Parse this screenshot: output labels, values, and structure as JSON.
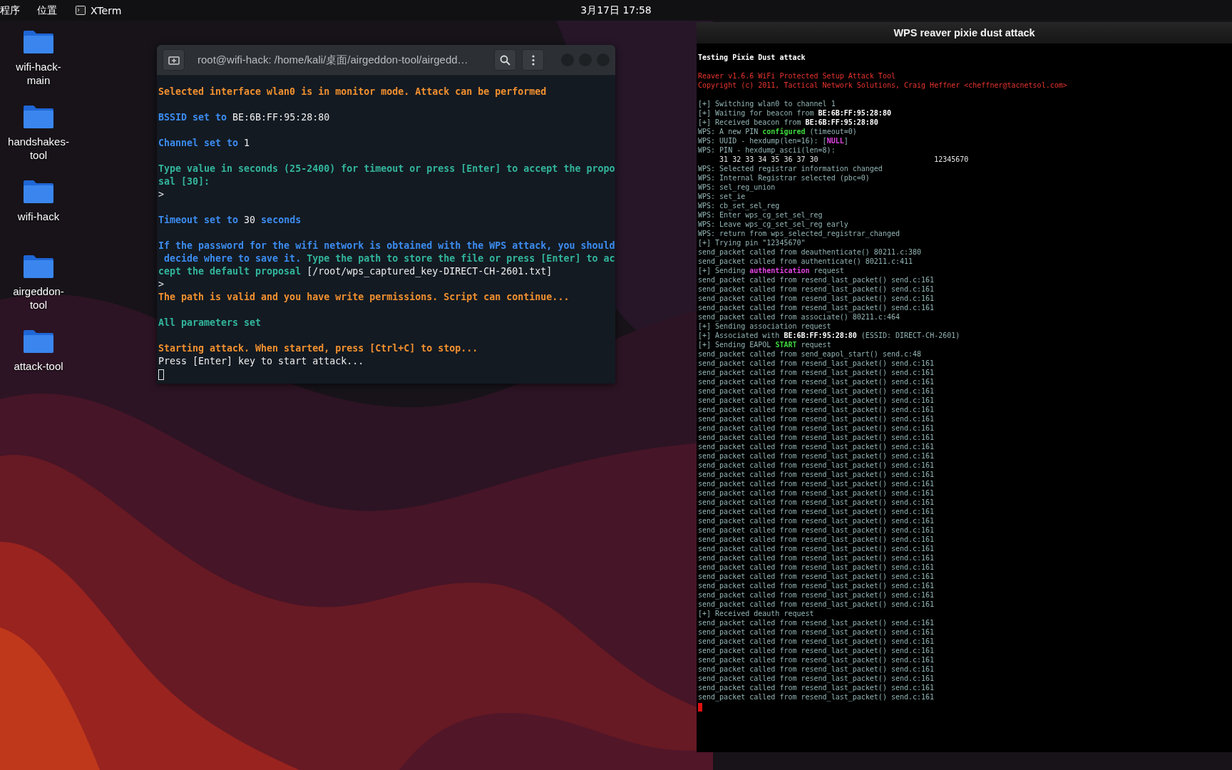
{
  "top_bar": {
    "apps_menu": "程序",
    "places_menu": "位置",
    "taskbar_app": "XTerm",
    "clock": "3月17日  17:58"
  },
  "desktop_icons": [
    {
      "label": "wifi-hack-main"
    },
    {
      "label": "handshakes-tool"
    },
    {
      "label": "wifi-hack"
    },
    {
      "label": "airgeddon-tool"
    },
    {
      "label": "attack-tool"
    }
  ],
  "terminal_window": {
    "title": "root@wifi-hack: /home/kali/桌面/airgeddon-tool/airgedd…",
    "lines": [
      {
        "kind": "blank"
      },
      {
        "kind": "text",
        "segments": [
          {
            "kind": "warning",
            "text": "Selected interface wlan0 is in monitor mode. Attack can be performed"
          }
        ]
      },
      {
        "kind": "blank"
      },
      {
        "kind": "text",
        "segments": [
          {
            "kind": "info",
            "text": "BSSID set to "
          },
          {
            "kind": "plain",
            "text": "BE:6B:FF:95:28:80"
          }
        ]
      },
      {
        "kind": "blank"
      },
      {
        "kind": "text",
        "segments": [
          {
            "kind": "info",
            "text": "Channel set to "
          },
          {
            "kind": "plain",
            "text": "1"
          }
        ]
      },
      {
        "kind": "blank"
      },
      {
        "kind": "text",
        "segments": [
          {
            "kind": "prompt",
            "text": "Type value in seconds (25-2400) for timeout or press [Enter] to accept the propo"
          }
        ]
      },
      {
        "kind": "text",
        "segments": [
          {
            "kind": "prompt",
            "text": "sal [30]:"
          }
        ]
      },
      {
        "kind": "text",
        "segments": [
          {
            "kind": "plain",
            "text": ">"
          }
        ]
      },
      {
        "kind": "blank"
      },
      {
        "kind": "text",
        "segments": [
          {
            "kind": "info",
            "text": "Timeout set to "
          },
          {
            "kind": "plain",
            "text": "30"
          },
          {
            "kind": "info",
            "text": " seconds"
          }
        ]
      },
      {
        "kind": "blank"
      },
      {
        "kind": "text",
        "segments": [
          {
            "kind": "info",
            "text": "If the password for the wifi network is obtained with the WPS attack, you should"
          }
        ]
      },
      {
        "kind": "text",
        "segments": [
          {
            "kind": "info",
            "text": " decide where to save it."
          },
          {
            "kind": "prompt",
            "text": " Type the path to store the file or press [Enter] to ac"
          }
        ]
      },
      {
        "kind": "text",
        "segments": [
          {
            "kind": "prompt",
            "text": "cept the default proposal"
          },
          {
            "kind": "plain",
            "text": " [/root/wps_captured_key-DIRECT-CH-2601.txt]"
          }
        ]
      },
      {
        "kind": "text",
        "segments": [
          {
            "kind": "plain",
            "text": ">"
          }
        ]
      },
      {
        "kind": "text",
        "segments": [
          {
            "kind": "warning",
            "text": "The path is valid and you have write permissions. Script can continue..."
          }
        ]
      },
      {
        "kind": "blank"
      },
      {
        "kind": "text",
        "segments": [
          {
            "kind": "prompt",
            "text": "All parameters set"
          }
        ]
      },
      {
        "kind": "blank"
      },
      {
        "kind": "text",
        "segments": [
          {
            "kind": "warning",
            "text": "Starting attack. When started, press [Ctrl+C] to stop..."
          }
        ]
      },
      {
        "kind": "text",
        "segments": [
          {
            "kind": "plain",
            "text": "Press [Enter] key to start attack..."
          }
        ]
      }
    ]
  },
  "xterm_window": {
    "title": "WPS reaver pixie dust attack",
    "lines": [
      {
        "kind": "blank"
      },
      {
        "kind": "text",
        "segments": [
          {
            "kind": "header",
            "text": "Testing Pixie Dust attack"
          }
        ]
      },
      {
        "kind": "blank"
      },
      {
        "kind": "text",
        "segments": [
          {
            "kind": "error",
            "text": "Reaver v1.6.6 WiFi Protected Setup Attack Tool"
          }
        ]
      },
      {
        "kind": "text",
        "segments": [
          {
            "kind": "error",
            "text": "Copyright (c) 2011, Tactical Network Solutions, Craig Heffner <cheffner@tacnetsol.com>"
          }
        ]
      },
      {
        "kind": "blank"
      },
      {
        "kind": "text",
        "segments": [
          {
            "kind": "log",
            "text": "[+] Switching wlan0 to channel 1"
          }
        ]
      },
      {
        "kind": "text",
        "segments": [
          {
            "kind": "log",
            "text": "[+] Waiting for beacon from "
          },
          {
            "kind": "highlight",
            "text": "BE:6B:FF:95:28:80"
          }
        ]
      },
      {
        "kind": "text",
        "segments": [
          {
            "kind": "log",
            "text": "[+] Received beacon from "
          },
          {
            "kind": "highlight",
            "text": "BE:6B:FF:95:28:80"
          }
        ]
      },
      {
        "kind": "text",
        "segments": [
          {
            "kind": "log",
            "text": "WPS: A new PIN "
          },
          {
            "kind": "success",
            "text": "configured"
          },
          {
            "kind": "log",
            "text": " (timeout=0)"
          }
        ]
      },
      {
        "kind": "text",
        "segments": [
          {
            "kind": "log",
            "text": "WPS: UUID - hexdump(len=16): ["
          },
          {
            "kind": "accent",
            "text": "NULL"
          },
          {
            "kind": "log",
            "text": "]"
          }
        ]
      },
      {
        "kind": "text",
        "segments": [
          {
            "kind": "log",
            "text": "WPS: PIN - hexdump_ascii(len=8):"
          }
        ]
      },
      {
        "kind": "text",
        "segments": [
          {
            "kind": "value",
            "text": "     31 32 33 34 35 36 37 30                           12345670"
          }
        ]
      },
      {
        "kind": "text",
        "segments": [
          {
            "kind": "log",
            "text": "WPS: Selected registrar information changed"
          }
        ]
      },
      {
        "kind": "text",
        "segments": [
          {
            "kind": "log",
            "text": "WPS: Internal Registrar selected (pbc=0)"
          }
        ]
      },
      {
        "kind": "text",
        "segments": [
          {
            "kind": "log",
            "text": "WPS: sel_reg_union"
          }
        ]
      },
      {
        "kind": "text",
        "segments": [
          {
            "kind": "log",
            "text": "WPS: set_ie"
          }
        ]
      },
      {
        "kind": "text",
        "segments": [
          {
            "kind": "log",
            "text": "WPS: cb_set_sel_reg"
          }
        ]
      },
      {
        "kind": "text",
        "segments": [
          {
            "kind": "log",
            "text": "WPS: Enter wps_cg_set_sel_reg"
          }
        ]
      },
      {
        "kind": "text",
        "segments": [
          {
            "kind": "log",
            "text": "WPS: Leave wps_cg_set_sel_reg early"
          }
        ]
      },
      {
        "kind": "text",
        "segments": [
          {
            "kind": "log",
            "text": "WPS: return from wps_selected_registrar_changed"
          }
        ]
      },
      {
        "kind": "text",
        "segments": [
          {
            "kind": "log",
            "text": "[+] Trying pin \"12345670\""
          }
        ]
      },
      {
        "kind": "text",
        "segments": [
          {
            "kind": "log",
            "text": "send_packet called from deauthenticate() 80211.c:380"
          }
        ]
      },
      {
        "kind": "text",
        "segments": [
          {
            "kind": "log",
            "text": "send_packet called from authenticate() 80211.c:411"
          }
        ]
      },
      {
        "kind": "text",
        "segments": [
          {
            "kind": "log",
            "text": "[+] Sending "
          },
          {
            "kind": "accent",
            "text": "authentication"
          },
          {
            "kind": "log",
            "text": " request"
          }
        ]
      },
      {
        "kind": "text",
        "segments": [
          {
            "kind": "log",
            "text": "send_packet called from resend_last_packet() send.c:161"
          }
        ]
      },
      {
        "kind": "text",
        "segments": [
          {
            "kind": "log",
            "text": "send_packet called from resend_last_packet() send.c:161"
          }
        ]
      },
      {
        "kind": "text",
        "segments": [
          {
            "kind": "log",
            "text": "send_packet called from resend_last_packet() send.c:161"
          }
        ]
      },
      {
        "kind": "text",
        "segments": [
          {
            "kind": "log",
            "text": "send_packet called from resend_last_packet() send.c:161"
          }
        ]
      },
      {
        "kind": "text",
        "segments": [
          {
            "kind": "log",
            "text": "send_packet called from associate() 80211.c:464"
          }
        ]
      },
      {
        "kind": "text",
        "segments": [
          {
            "kind": "log",
            "text": "[+] Sending association request"
          }
        ]
      },
      {
        "kind": "text",
        "segments": [
          {
            "kind": "log",
            "text": "[+] Associated with "
          },
          {
            "kind": "highlight",
            "text": "BE:6B:FF:95:28:80"
          },
          {
            "kind": "log",
            "text": " (ESSID: DIRECT-CH-2601)"
          }
        ]
      },
      {
        "kind": "text",
        "segments": [
          {
            "kind": "log",
            "text": "[+] Sending EAPOL "
          },
          {
            "kind": "success",
            "text": "START"
          },
          {
            "kind": "log",
            "text": " request"
          }
        ]
      },
      {
        "kind": "text",
        "segments": [
          {
            "kind": "log",
            "text": "send_packet called from send_eapol_start() send.c:48"
          }
        ]
      },
      {
        "kind": "text",
        "segments": [
          {
            "kind": "log",
            "text": "send_packet called from resend_last_packet() send.c:161"
          }
        ]
      },
      {
        "kind": "text",
        "segments": [
          {
            "kind": "log",
            "text": "send_packet called from resend_last_packet() send.c:161"
          }
        ]
      },
      {
        "kind": "text",
        "segments": [
          {
            "kind": "log",
            "text": "send_packet called from resend_last_packet() send.c:161"
          }
        ]
      },
      {
        "kind": "text",
        "segments": [
          {
            "kind": "log",
            "text": "send_packet called from resend_last_packet() send.c:161"
          }
        ]
      },
      {
        "kind": "text",
        "segments": [
          {
            "kind": "log",
            "text": "send_packet called from resend_last_packet() send.c:161"
          }
        ]
      },
      {
        "kind": "text",
        "segments": [
          {
            "kind": "log",
            "text": "send_packet called from resend_last_packet() send.c:161"
          }
        ]
      },
      {
        "kind": "text",
        "segments": [
          {
            "kind": "log",
            "text": "send_packet called from resend_last_packet() send.c:161"
          }
        ]
      },
      {
        "kind": "text",
        "segments": [
          {
            "kind": "log",
            "text": "send_packet called from resend_last_packet() send.c:161"
          }
        ]
      },
      {
        "kind": "text",
        "segments": [
          {
            "kind": "log",
            "text": "send_packet called from resend_last_packet() send.c:161"
          }
        ]
      },
      {
        "kind": "text",
        "segments": [
          {
            "kind": "log",
            "text": "send_packet called from resend_last_packet() send.c:161"
          }
        ]
      },
      {
        "kind": "text",
        "segments": [
          {
            "kind": "log",
            "text": "send_packet called from resend_last_packet() send.c:161"
          }
        ]
      },
      {
        "kind": "text",
        "segments": [
          {
            "kind": "log",
            "text": "send_packet called from resend_last_packet() send.c:161"
          }
        ]
      },
      {
        "kind": "text",
        "segments": [
          {
            "kind": "log",
            "text": "send_packet called from resend_last_packet() send.c:161"
          }
        ]
      },
      {
        "kind": "text",
        "segments": [
          {
            "kind": "log",
            "text": "send_packet called from resend_last_packet() send.c:161"
          }
        ]
      },
      {
        "kind": "text",
        "segments": [
          {
            "kind": "log",
            "text": "send_packet called from resend_last_packet() send.c:161"
          }
        ]
      },
      {
        "kind": "text",
        "segments": [
          {
            "kind": "log",
            "text": "send_packet called from resend_last_packet() send.c:161"
          }
        ]
      },
      {
        "kind": "text",
        "segments": [
          {
            "kind": "log",
            "text": "send_packet called from resend_last_packet() send.c:161"
          }
        ]
      },
      {
        "kind": "text",
        "segments": [
          {
            "kind": "log",
            "text": "send_packet called from resend_last_packet() send.c:161"
          }
        ]
      },
      {
        "kind": "text",
        "segments": [
          {
            "kind": "log",
            "text": "send_packet called from resend_last_packet() send.c:161"
          }
        ]
      },
      {
        "kind": "text",
        "segments": [
          {
            "kind": "log",
            "text": "send_packet called from resend_last_packet() send.c:161"
          }
        ]
      },
      {
        "kind": "text",
        "segments": [
          {
            "kind": "log",
            "text": "send_packet called from resend_last_packet() send.c:161"
          }
        ]
      },
      {
        "kind": "text",
        "segments": [
          {
            "kind": "log",
            "text": "send_packet called from resend_last_packet() send.c:161"
          }
        ]
      },
      {
        "kind": "text",
        "segments": [
          {
            "kind": "log",
            "text": "send_packet called from resend_last_packet() send.c:161"
          }
        ]
      },
      {
        "kind": "text",
        "segments": [
          {
            "kind": "log",
            "text": "send_packet called from resend_last_packet() send.c:161"
          }
        ]
      },
      {
        "kind": "text",
        "segments": [
          {
            "kind": "log",
            "text": "send_packet called from resend_last_packet() send.c:161"
          }
        ]
      },
      {
        "kind": "text",
        "segments": [
          {
            "kind": "log",
            "text": "send_packet called from resend_last_packet() send.c:161"
          }
        ]
      },
      {
        "kind": "text",
        "segments": [
          {
            "kind": "log",
            "text": "send_packet called from resend_last_packet() send.c:161"
          }
        ]
      },
      {
        "kind": "text",
        "segments": [
          {
            "kind": "log",
            "text": "[+] Received deauth request"
          }
        ]
      },
      {
        "kind": "text",
        "segments": [
          {
            "kind": "log",
            "text": "send_packet called from resend_last_packet() send.c:161"
          }
        ]
      },
      {
        "kind": "text",
        "segments": [
          {
            "kind": "log",
            "text": "send_packet called from resend_last_packet() send.c:161"
          }
        ]
      },
      {
        "kind": "text",
        "segments": [
          {
            "kind": "log",
            "text": "send_packet called from resend_last_packet() send.c:161"
          }
        ]
      },
      {
        "kind": "text",
        "segments": [
          {
            "kind": "log",
            "text": "send_packet called from resend_last_packet() send.c:161"
          }
        ]
      },
      {
        "kind": "text",
        "segments": [
          {
            "kind": "log",
            "text": "send_packet called from resend_last_packet() send.c:161"
          }
        ]
      },
      {
        "kind": "text",
        "segments": [
          {
            "kind": "log",
            "text": "send_packet called from resend_last_packet() send.c:161"
          }
        ]
      },
      {
        "kind": "text",
        "segments": [
          {
            "kind": "log",
            "text": "send_packet called from resend_last_packet() send.c:161"
          }
        ]
      },
      {
        "kind": "text",
        "segments": [
          {
            "kind": "log",
            "text": "send_packet called from resend_last_packet() send.c:161"
          }
        ]
      },
      {
        "kind": "text",
        "segments": [
          {
            "kind": "log",
            "text": "send_packet called from resend_last_packet() send.c:161"
          }
        ]
      }
    ]
  }
}
